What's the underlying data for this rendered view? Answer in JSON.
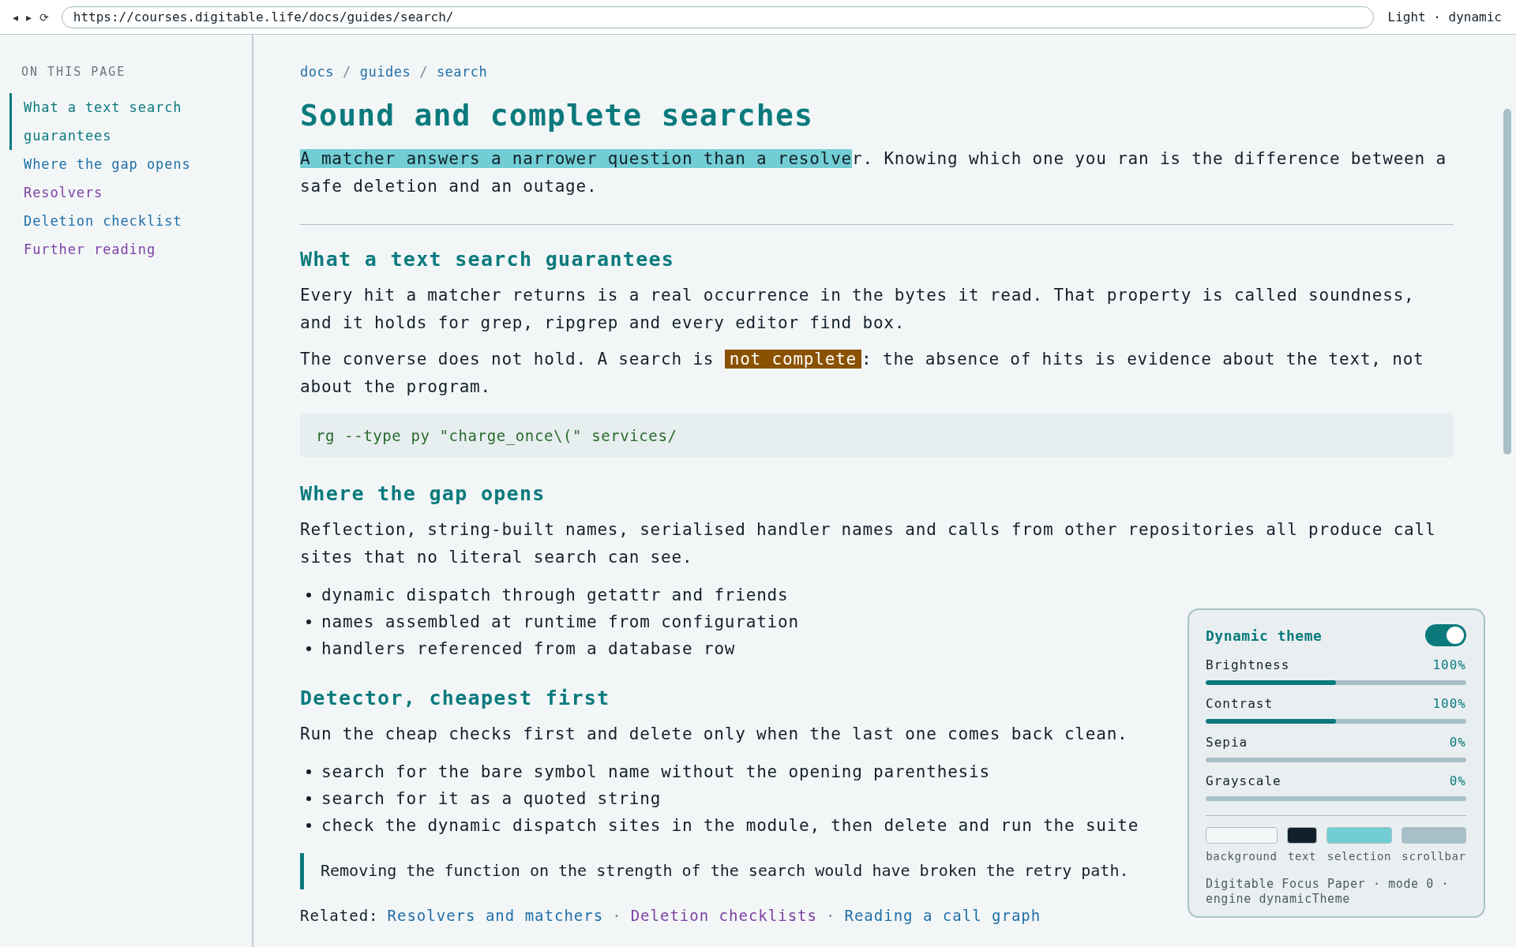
{
  "browser": {
    "nav": [
      "◂",
      "▸",
      "⟳"
    ],
    "url": "https://courses.digitable.life/docs/guides/search/",
    "theme_label": "Light · dynamic"
  },
  "toc": {
    "heading": "ON THIS PAGE",
    "items": [
      {
        "label": "What a text search guarantees",
        "selected": true,
        "visited": false
      },
      {
        "label": "Where the gap opens",
        "selected": false,
        "visited": false
      },
      {
        "label": "Resolvers",
        "selected": false,
        "visited": true
      },
      {
        "label": "Deletion checklist",
        "selected": false,
        "visited": false
      },
      {
        "label": "Further reading",
        "selected": false,
        "visited": true
      }
    ]
  },
  "breadcrumb": {
    "separator": "/",
    "items": [
      "docs",
      "guides",
      "search"
    ]
  },
  "title": "Sound and complete searches",
  "lead": [
    {
      "text": "A matcher answers a narrower question than a resolve",
      "kind": "selection"
    },
    {
      "text": "r. Knowing which one you ran is the difference between a safe deletion and an outage.",
      "kind": "plain"
    }
  ],
  "sections": [
    {
      "heading": "What a text search guarantees",
      "blocks": [
        {
          "kind": "paragraph",
          "segments": [
            {
              "text": "Every hit a matcher returns is a real occurrence in the bytes it read. That property is called soundness, and it holds for grep, ripgrep and every editor find box.",
              "kind": "plain"
            }
          ]
        },
        {
          "kind": "paragraph",
          "segments": [
            {
              "text": "The converse does not hold. A search is ",
              "kind": "plain"
            },
            {
              "text": "not complete",
              "kind": "mark"
            },
            {
              "text": ": the absence of hits is evidence about the text, not about the program.",
              "kind": "plain"
            }
          ]
        },
        {
          "kind": "code",
          "text": "rg --type py \"charge_once\\(\" services/"
        }
      ]
    },
    {
      "heading": "Where the gap opens",
      "blocks": [
        {
          "kind": "paragraph",
          "segments": [
            {
              "text": "Reflection, string-built names, serialised handler names and calls from other repositories all produce call sites that no literal search can see.",
              "kind": "plain"
            }
          ]
        },
        {
          "kind": "list",
          "items": [
            "dynamic dispatch through getattr and friends",
            "names assembled at runtime from configuration",
            "handlers referenced from a database row"
          ]
        }
      ]
    },
    {
      "heading": "Detector, cheapest first",
      "blocks": [
        {
          "kind": "paragraph",
          "segments": [
            {
              "text": "Run the cheap checks first and delete only when the last one comes back clean.",
              "kind": "plain"
            }
          ]
        },
        {
          "kind": "list",
          "items": [
            "search for the bare symbol name without the opening parenthesis",
            "search for it as a quoted string",
            "check the dynamic dispatch sites in the module, then delete and run the suite"
          ]
        },
        {
          "kind": "quote",
          "text": "Removing the function on the strength of the search would have broken the retry path."
        }
      ]
    }
  ],
  "related": {
    "label": "Related:",
    "separator": "·",
    "links": [
      {
        "label": "Resolvers and matchers",
        "visited": false
      },
      {
        "label": "Deletion checklists",
        "visited": true
      },
      {
        "label": "Reading a call graph",
        "visited": false
      }
    ]
  },
  "theme_panel": {
    "title": "Dynamic theme",
    "on": true,
    "sliders": [
      {
        "label": "Brightness",
        "reading": "100%",
        "level": 0.5
      },
      {
        "label": "Contrast",
        "reading": "100%",
        "level": 0.5
      },
      {
        "label": "Sepia",
        "reading": "0%"
      },
      {
        "label": "Grayscale",
        "reading": "0%"
      }
    ],
    "swatches": [
      {
        "label": "background",
        "color": "#f3f6f7"
      },
      {
        "label": "text",
        "color": "#13202a"
      },
      {
        "label": "selection",
        "color": "#72ced4"
      },
      {
        "label": "scrollbar",
        "color": "#a7bfc6"
      }
    ],
    "footer": "Digitable Focus Paper · mode 0 · engine dynamicTheme"
  }
}
